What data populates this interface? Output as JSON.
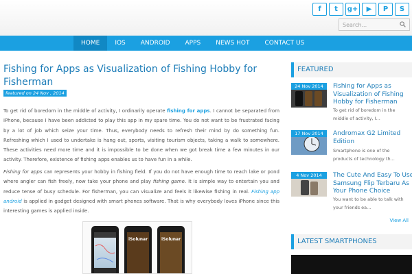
{
  "social": {
    "icons": [
      {
        "name": "facebook-icon",
        "glyph": "f"
      },
      {
        "name": "twitter-icon",
        "glyph": "t"
      },
      {
        "name": "google-plus-icon",
        "glyph": "g+"
      },
      {
        "name": "youtube-icon",
        "glyph": "▶"
      },
      {
        "name": "pinterest-icon",
        "glyph": "P"
      },
      {
        "name": "skype-icon",
        "glyph": "S"
      }
    ]
  },
  "search": {
    "placeholder": "Search..."
  },
  "nav": {
    "items": [
      "HOME",
      "IOS",
      "ANDROID",
      "APPS",
      "NEWS HOT",
      "CONTACT US"
    ],
    "active": "HOME"
  },
  "article": {
    "title": "Fishing for Apps as Visualization of Fishing Hobby for Fisherman",
    "date": "featured on 24 Nov , 2014",
    "p1_a": "To get rid of boredom in the middle of activity, I ordinarily operate ",
    "p1_hl": "fishing for apps",
    "p1_b": ". I cannot be separated from iPhone, because I have been addicted to play this app in my spare time. You do not want to be frustrated facing by a lot of job which seize your time. Thus, everybody needs to refresh their mind by do something fun. Refreshing which I used to undertake is hang out, sports, visiting tourism objects, taking a walk to somewhere. These activities need more time and it is impossible to be done when we got break time a few minutes in our activity. Therefore, existence of fishing apps enables us to have fun in a while.",
    "p2_a": "Fishing for apps",
    "p2_b": " can represents your hobby in fishing field. If you do not have enough time to reach lake or pond where angler can fish freely, now take your phone and play ",
    "p2_c": "fishing game",
    "p2_d": ". It is simple way to entertain you and reduce tense of busy schedule. For fisherman, you can visualize and feels it likewise fishing in real. ",
    "p2_e": "Fishing app android",
    "p2_f": " is applied in gadget designed with smart phones software. That is why everybody loves iPhone since this interesting games is applied inside.",
    "phone_labels": [
      "",
      "iSolunar",
      "iSolunar"
    ]
  },
  "sidebar": {
    "featured_heading": "FEATURED",
    "featured": [
      {
        "date": "24 Nov 2014",
        "title": "Fishing for Apps as\nVisualization of Fishing\nHobby for Fisherman",
        "summary": "To get rid of boredom in the\nmiddle of activity, I..."
      },
      {
        "date": "17 Nov 2014",
        "title": "Andromax G2 Limited\nEdition",
        "summary": "Smartphone is one of the\nproducts of technology th..."
      },
      {
        "date": "4 Nov 2014",
        "title": "The Cute And Easy To Use\nSamsung Flip Terbaru As\nYour Phone Choice",
        "summary": "You want to be able to talk with\nyour friends ea..."
      }
    ],
    "view_all": "View All",
    "latest_heading": "LATEST SMARTPHONES"
  },
  "colors": {
    "accent": "#1ba0e1",
    "nav_active": "#1188c4",
    "title": "#1d7db8"
  }
}
